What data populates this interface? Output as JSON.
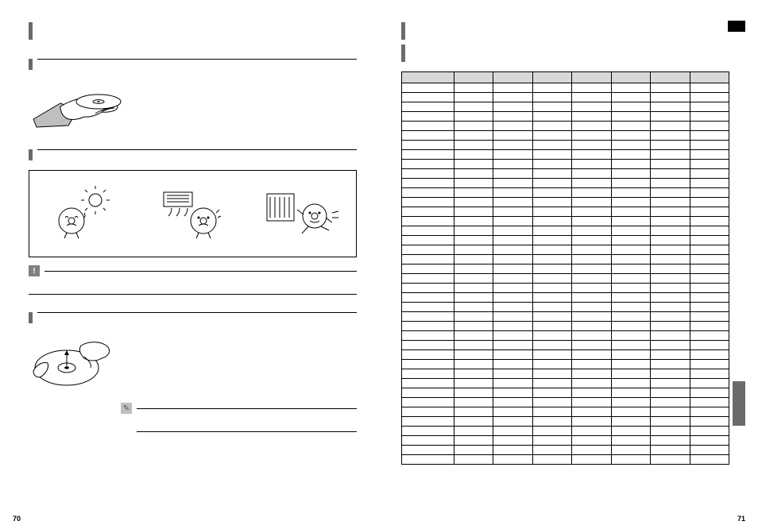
{
  "left": {
    "page_number": "70",
    "section1_label": "",
    "section2_label": "",
    "section3_label": "",
    "note_icon": "!",
    "pencil_icon": "✎"
  },
  "right": {
    "page_number": "71",
    "table": {
      "columns": [
        "",
        "",
        "",
        "",
        "",
        "",
        "",
        ""
      ],
      "row_count": 40
    }
  }
}
